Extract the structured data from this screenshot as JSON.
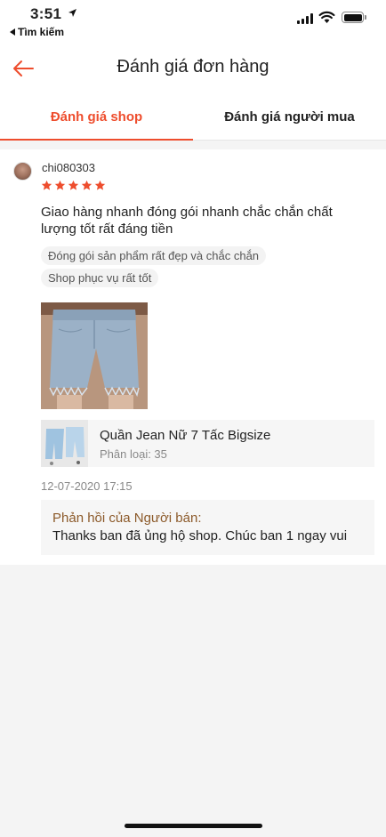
{
  "status_bar": {
    "time": "3:51",
    "back_app_label": "Tìm kiếm"
  },
  "header": {
    "title": "Đánh giá đơn hàng"
  },
  "tabs": [
    {
      "label": "Đánh giá shop",
      "active": true
    },
    {
      "label": "Đánh giá người mua",
      "active": false
    }
  ],
  "review": {
    "username": "chi080303",
    "rating": 5,
    "text": "Giao hàng nhanh  đóng gói nhanh chắc chắn chất lượng tốt rất đáng tiền",
    "tags": [
      "Đóng gói sản phẩm rất đẹp và chắc chắn",
      "Shop phục vụ rất tốt"
    ],
    "product": {
      "name": "Quần Jean Nữ 7 Tấc Bigsize",
      "variation": "Phân loại: 35"
    },
    "date": "12-07-2020 17:15",
    "seller_reply": {
      "label": "Phản hồi của Người bán:",
      "text": "Thanks ban đã ủng hộ shop. Chúc ban 1 ngay vui"
    }
  },
  "colors": {
    "accent": "#ee4d2d",
    "star": "#ee4d2d",
    "reply_label": "#8c5a2a"
  }
}
